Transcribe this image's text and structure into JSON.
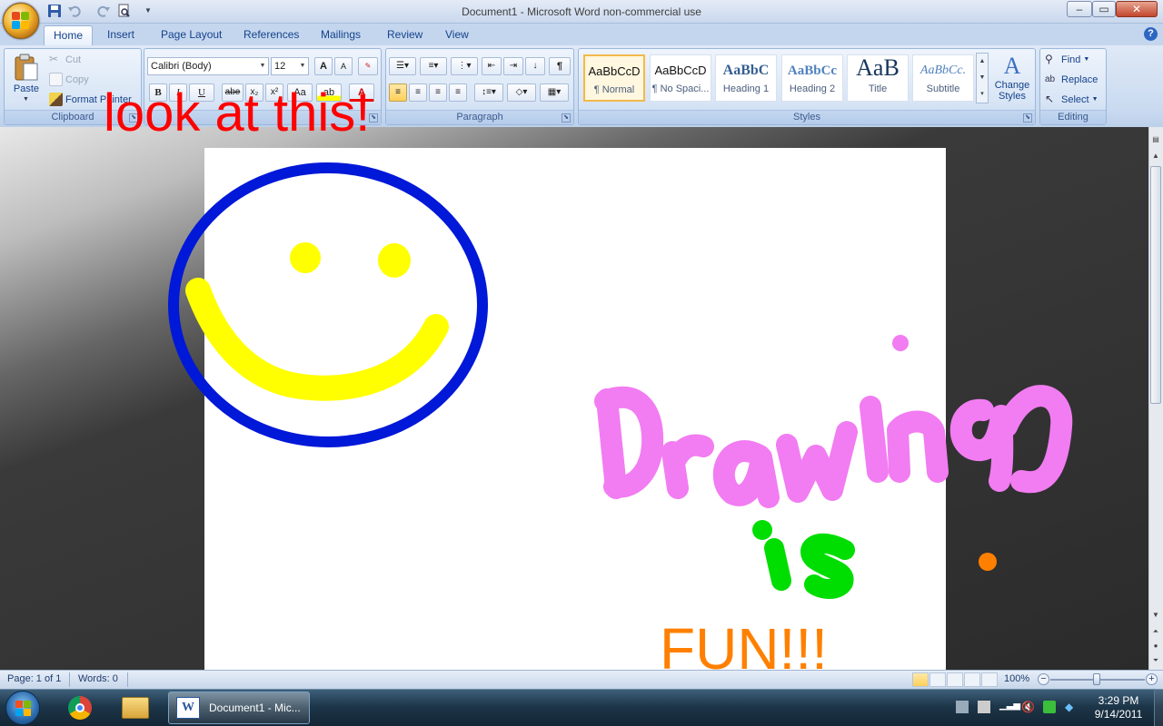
{
  "window": {
    "title": "Document1 - Microsoft Word non-commercial use",
    "controls": {
      "minimize": "–",
      "maximize": "▭",
      "close": "✕"
    }
  },
  "ribbon_tabs": [
    "Home",
    "Insert",
    "Page Layout",
    "References",
    "Mailings",
    "Review",
    "View"
  ],
  "help": "?",
  "clipboard": {
    "paste": "Paste",
    "cut": "Cut",
    "copy": "Copy",
    "format_painter": "Format Painter",
    "label": "Clipboard"
  },
  "font": {
    "name": "Calibri (Body)",
    "size": "12",
    "grow": "A",
    "shrink": "A",
    "bold": "B",
    "italic": "I",
    "underline": "U",
    "strikethrough": "abe",
    "subscript": "x₂",
    "superscript": "x²",
    "change_case": "Aa",
    "font_color": "A"
  },
  "paragraph": {
    "label": "Paragraph",
    "show_marks": "¶"
  },
  "styles": {
    "label": "Styles",
    "items": [
      {
        "preview": "AaBbCcD",
        "name": "¶ Normal"
      },
      {
        "preview": "AaBbCcD",
        "name": "¶ No Spaci..."
      },
      {
        "preview": "AaBbC",
        "name": "Heading 1"
      },
      {
        "preview": "AaBbCc",
        "name": "Heading 2"
      },
      {
        "preview": "AaB",
        "name": "Title"
      },
      {
        "preview": "AaBbCc.",
        "name": "Subtitle"
      }
    ],
    "change_styles_line1": "Change",
    "change_styles_line2": "Styles"
  },
  "editing": {
    "find": "Find",
    "replace": "Replace",
    "select": "Select",
    "label": "Editing"
  },
  "document": {
    "overlay_text": "look at this!",
    "drawing_words": [
      "Drawing",
      "is",
      "FUN!!!"
    ]
  },
  "status_bar": {
    "page": "Page: 1 of 1",
    "words": "Words: 0",
    "zoom": "100%",
    "zoom_level_fraction": 0.5
  },
  "taskbar": {
    "word_item": "Document1 - Mic...",
    "time": "3:29 PM",
    "date": "9/14/2011"
  },
  "colors": {
    "overlay_text": "#ff0000",
    "smiley_outline": "#0018d8",
    "smiley_features": "#ffff00",
    "drawing_word": "#f27cf2",
    "is_word": "#00dd00",
    "fun_word": "#ff8000"
  }
}
